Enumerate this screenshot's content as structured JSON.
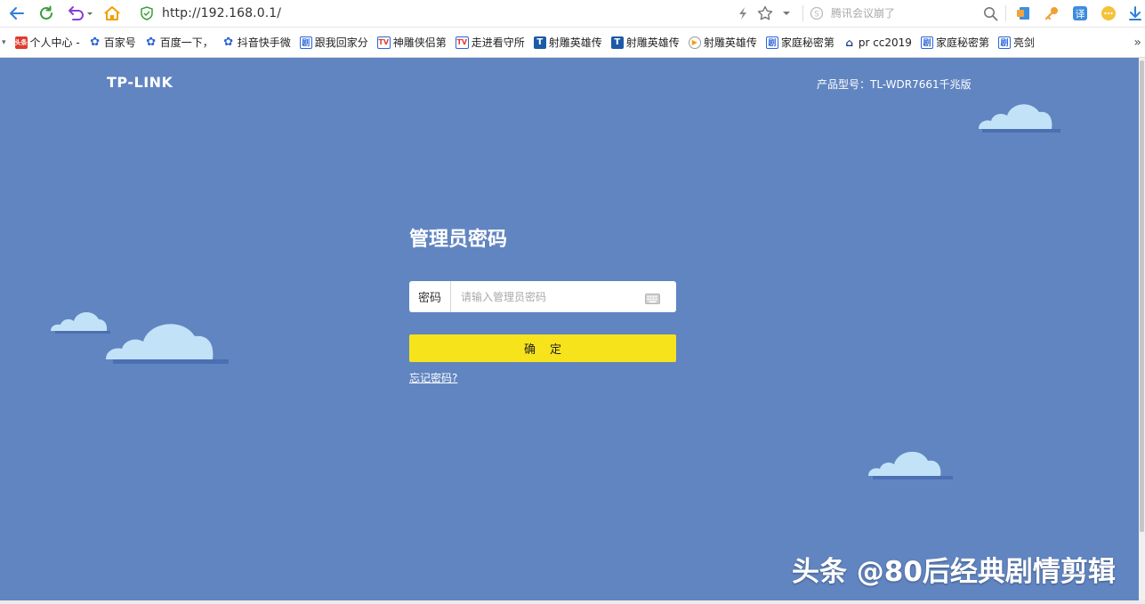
{
  "browser": {
    "url": "http://192.168.0.1/",
    "search_placeholder": "腾讯会议崩了"
  },
  "bookmarks": [
    {
      "label": "个人中心 -",
      "icon": "toutiao-icon"
    },
    {
      "label": "百家号",
      "icon": "baidu-paw-icon"
    },
    {
      "label": "百度一下，",
      "icon": "baidu-paw-icon"
    },
    {
      "label": "抖音快手微",
      "icon": "baidu-paw-icon"
    },
    {
      "label": "跟我回家分",
      "icon": "drama-icon"
    },
    {
      "label": "神雕侠侣第",
      "icon": "tv-icon"
    },
    {
      "label": "走进看守所",
      "icon": "tv-icon"
    },
    {
      "label": "射雕英雄传",
      "icon": "t-icon"
    },
    {
      "label": "射雕英雄传",
      "icon": "t-icon"
    },
    {
      "label": "射雕英雄传",
      "icon": "video-icon"
    },
    {
      "label": "家庭秘密第",
      "icon": "drama-icon"
    },
    {
      "label": "pr cc2019",
      "icon": "home-icon"
    },
    {
      "label": "家庭秘密第",
      "icon": "drama-icon"
    },
    {
      "label": "亮剑",
      "icon": "drama-icon"
    }
  ],
  "page": {
    "logo": "TP-LINK",
    "model": "产品型号：TL-WDR7661千兆版",
    "title": "管理员密码",
    "password_label": "密码",
    "password_placeholder": "请输入管理员密码",
    "confirm_label": "确定",
    "forgot_label": "忘记密码?",
    "watermark": "头条 @80后经典剧情剪辑"
  },
  "colors": {
    "page_bg": "#6185c1",
    "button_yellow": "#f7e31c",
    "cloud_light": "#c2e2f8",
    "cloud_shadow": "#4c6fb3"
  }
}
